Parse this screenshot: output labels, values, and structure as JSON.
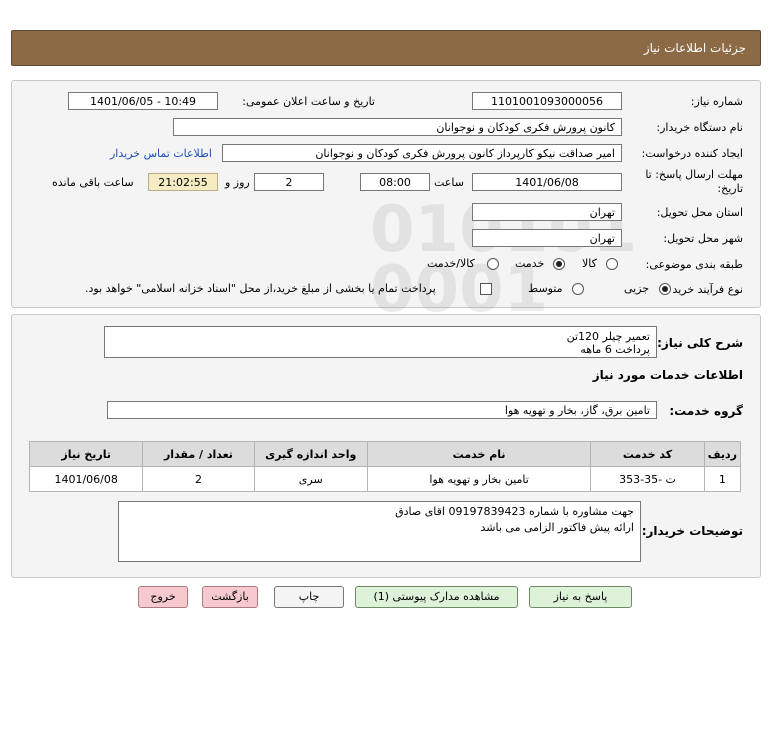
{
  "header": {
    "title": "جزئیات اطلاعات نیاز"
  },
  "form": {
    "need_number": {
      "label": "شماره نیاز:",
      "value": "1101001093000056"
    },
    "announce_datetime": {
      "label": "تاریخ و ساعت اعلان عمومی:",
      "value": "1401/06/05 - 10:49"
    },
    "buyer_org": {
      "label": "نام دستگاه خریدار:",
      "value": "کانون پرورش فکری کودکان و نوجوانان"
    },
    "requester": {
      "label": "ایجاد کننده درخواست:",
      "value": "امیر صداقت نیکو کارپرداز کانون پرورش فکری کودکان و نوجوانان",
      "contact_link": "اطلاعات تماس خریدار"
    },
    "deadline": {
      "label_line1": "مهلت ارسال پاسخ: تا",
      "label_line2": "تاریخ:",
      "date": "1401/06/08",
      "time_label": "ساعت",
      "time": "08:00",
      "days": "2",
      "days_label": "روز و",
      "remaining_time": "21:02:55",
      "remaining_label": "ساعت باقی مانده"
    },
    "province": {
      "label": "استان محل تحویل:",
      "value": "تهران"
    },
    "city": {
      "label": "شهر محل تحویل:",
      "value": "تهران"
    },
    "category": {
      "label": "طبقه بندی موضوعی:",
      "options": [
        "کالا",
        "خدمت",
        "کالا/خدمت"
      ],
      "selected": "خدمت"
    },
    "purchase_type": {
      "label": "نوع فرآیند خرید :",
      "options": [
        "جزیی",
        "متوسط"
      ],
      "selected": "جزیی",
      "payment_note": "پرداخت تمام یا بخشی از مبلغ خرید،از محل \"اسناد خزانه اسلامی\" خواهد بود."
    }
  },
  "need": {
    "summary_label": "شرح کلی نیاز:",
    "summary_line1": "تعمیر چیلر 120تن",
    "summary_line2": "پرداخت 6 ماهه",
    "services_title": "اطلاعات خدمات مورد نیاز",
    "service_group_label": "گروه خدمت:",
    "service_group_value": "تامین برق، گاز، بخار و تهویه هوا",
    "table": {
      "headers": [
        "ردیف",
        "کد خدمت",
        "نام خدمت",
        "واحد اندازه گیری",
        "تعداد / مقدار",
        "تاریخ نیاز"
      ],
      "rows": [
        [
          "1",
          "ت -35-353",
          "تامین بخار و تهویه هوا",
          "سری",
          "2",
          "1401/06/08"
        ]
      ]
    },
    "buyer_notes_label": "توضیحات خریدار:",
    "buyer_notes_line1": "جهت مشاوره با شماره 09197839423 اقای صادق",
    "buyer_notes_line2": "ارائه پیش فاکتور الزامی می باشد"
  },
  "buttons": {
    "reply": "پاسخ به نیاز",
    "view_docs": "مشاهده مدارک پیوستی (1)",
    "print": "چاپ",
    "back": "بازگشت",
    "exit": "خروج"
  },
  "colors": {
    "header_bg": "#8c6a45",
    "reply_bg": "#ddf2d8",
    "back_bg": "#f6c9cf",
    "remaining_bg": "#f5ecc4"
  }
}
